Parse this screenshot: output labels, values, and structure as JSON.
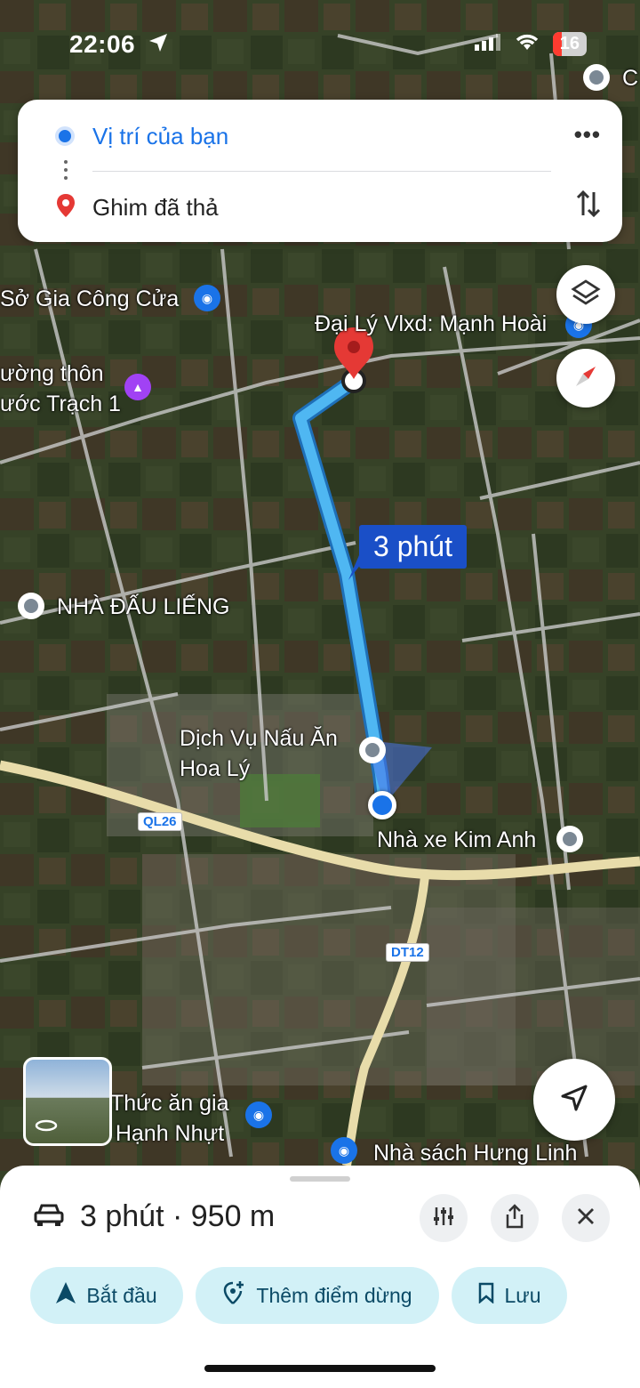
{
  "status_bar": {
    "time": "22:06",
    "battery": "16"
  },
  "route": {
    "origin": "Vị trí của bạn",
    "destination": "Ghim đã thả",
    "more_label": "•••"
  },
  "map": {
    "eta_bubble": "3 phút",
    "labels": {
      "so_gia_cong": "Sở Gia Công Cửa",
      "dai_ly": "Đại Lý Vlxd: Mạnh Hoài",
      "truong_thon_1": "ường thôn",
      "truong_thon_2": "ước Trạch 1",
      "nha_dau_lieng": "NHÀ ĐẤU LIẾNG",
      "dich_vu_1": "Dịch Vụ Nấu Ăn",
      "dich_vu_2": "Hoa Lý",
      "nha_xe": "Nhà xe Kim Anh",
      "thuc_an_1": "Thức ăn gia",
      "thuc_an_2": "súc Hạnh Nhựt",
      "nha_sach": "Nhà sách Hưng Linh",
      "corner": "C"
    },
    "roads": {
      "ql26": "QL26",
      "dt12": "DT12"
    }
  },
  "sheet": {
    "summary": "3 phút · 950 m",
    "buttons": {
      "start": "Bắt đầu",
      "add_stop": "Thêm điểm dừng",
      "save": "Lưu"
    }
  },
  "colors": {
    "route": "#4fb7f2",
    "accent": "#1a73e8",
    "pill_bg": "#d2f1f7",
    "pin": "#e53935"
  }
}
